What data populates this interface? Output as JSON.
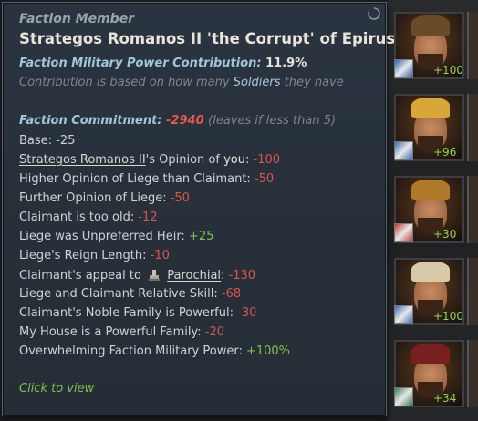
{
  "tooltip": {
    "header": "Faction Member",
    "title_pre": "Strategos Romanos II '",
    "title_epithet": "the Corrupt",
    "title_post": "' of Epirus",
    "power_label": "Faction Military Power Contribution:",
    "power_value": "11.9%",
    "contrib_pre": "Contribution is based on how many",
    "contrib_hl": "Soldiers",
    "contrib_post": "they have",
    "commit_label": "Faction Commitment:",
    "commit_value": "-2940",
    "commit_note": "(leaves if less than 5)",
    "base_label": "Base:",
    "base_value": "-25",
    "opinion_name": "Strategos Romanos II",
    "opinion_mid": "'s Opinion of",
    "opinion_you": "you",
    "opinion_value": "-100",
    "rows": [
      {
        "label": "Higher Opinion of Liege than Claimant:",
        "value": "-50",
        "tone": "red"
      },
      {
        "label": "Further Opinion of Liege:",
        "value": "-50",
        "tone": "red"
      },
      {
        "label": "Claimant is too old:",
        "value": "-12",
        "tone": "red"
      },
      {
        "label": "Liege was Unpreferred Heir:",
        "value": "+25",
        "tone": "green"
      },
      {
        "label": "Liege's Reign Length:",
        "value": "-10",
        "tone": "red"
      }
    ],
    "appeal_label": "Claimant's appeal to",
    "appeal_link": "Parochial",
    "appeal_value": "-130",
    "rows2": [
      {
        "label": "Liege and Claimant Relative Skill:",
        "value": "-68",
        "tone": "red"
      },
      {
        "label": "Claimant's Noble Family is Powerful:",
        "value": "-30",
        "tone": "red"
      },
      {
        "label": "My House is a Powerful Family:",
        "value": "-20",
        "tone": "red"
      },
      {
        "label": "Overwhelming Faction Military Power:",
        "value": "+100%",
        "tone": "green"
      }
    ],
    "click_text": "Click to view"
  },
  "members": [
    {
      "score": "+100",
      "hat_color": "#6b4a2a",
      "badge_color": "#2d5fa8"
    },
    {
      "score": "+96",
      "hat_color": "#d9a63a",
      "badge_color": "#3a6ab8"
    },
    {
      "score": "+30",
      "hat_color": "#b07a2a",
      "badge_color": "#b83a32"
    },
    {
      "score": "+100",
      "hat_color": "#d8c9a8",
      "badge_color": "#3a6ab8"
    },
    {
      "score": "+34",
      "hat_color": "#7a1f1f",
      "badge_color": "#3a7a5a"
    }
  ]
}
